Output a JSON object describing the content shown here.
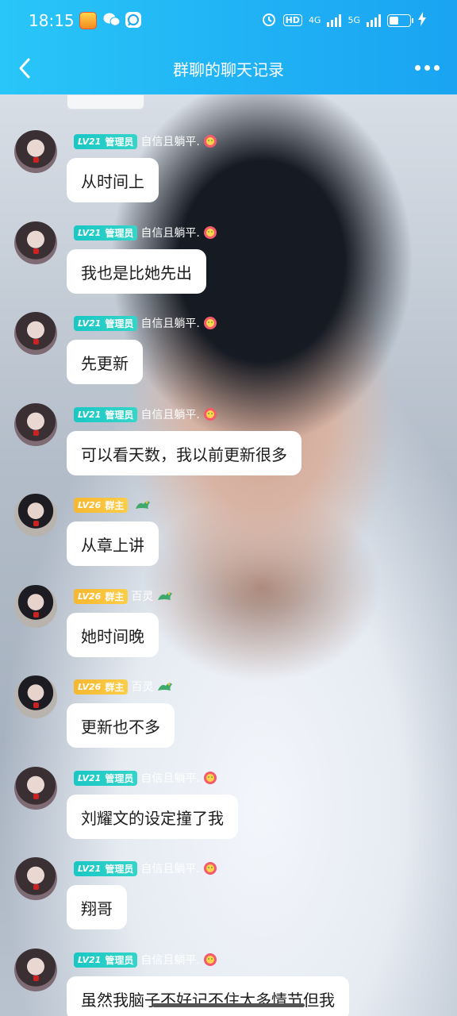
{
  "status_bar": {
    "time": "18:15",
    "hd_label": "HD",
    "net_4g": "4G",
    "net_5g": "5G"
  },
  "nav": {
    "title": "群聊的聊天记录"
  },
  "messages": [
    {
      "level": "LV21",
      "role": "管理员",
      "name": "自信且躺平.",
      "text": "从时间上",
      "type": "admin"
    },
    {
      "level": "LV21",
      "role": "管理员",
      "name": "自信且躺平.",
      "text": "我也是比她先出",
      "type": "admin"
    },
    {
      "level": "LV21",
      "role": "管理员",
      "name": "自信且躺平.",
      "text": "先更新",
      "type": "admin"
    },
    {
      "level": "LV21",
      "role": "管理员",
      "name": "自信且躺平.",
      "text": "可以看天数，我以前更新很多",
      "type": "admin"
    },
    {
      "level": "LV26",
      "role": "群主",
      "name": "",
      "text": "从章上讲",
      "type": "owner"
    },
    {
      "level": "LV26",
      "role": "群主",
      "name": "百灵",
      "text": "她时间晚",
      "type": "owner"
    },
    {
      "level": "LV26",
      "role": "群主",
      "name": "百灵",
      "text": "更新也不多",
      "type": "owner"
    },
    {
      "level": "LV21",
      "role": "管理员",
      "name": "自信且躺平.",
      "text": "刘耀文的设定撞了我",
      "type": "admin"
    },
    {
      "level": "LV21",
      "role": "管理员",
      "name": "自信且躺平.",
      "text": "翔哥",
      "type": "admin"
    },
    {
      "level": "LV21",
      "role": "管理员",
      "name": "自信且躺平.",
      "text": "虽然我脑子不好记不住太多情节但我",
      "type": "admin"
    }
  ],
  "icons": {
    "back": "chevron-left-icon",
    "more": "more-dots-icon",
    "admin_badge": "flower-face-icon",
    "owner_badge": "dragon-icon"
  },
  "colors": {
    "header": "#20b2f5",
    "admin_tag": "#1ac7c4",
    "owner_tag": "#f6b730",
    "bubble": "#ffffff"
  }
}
